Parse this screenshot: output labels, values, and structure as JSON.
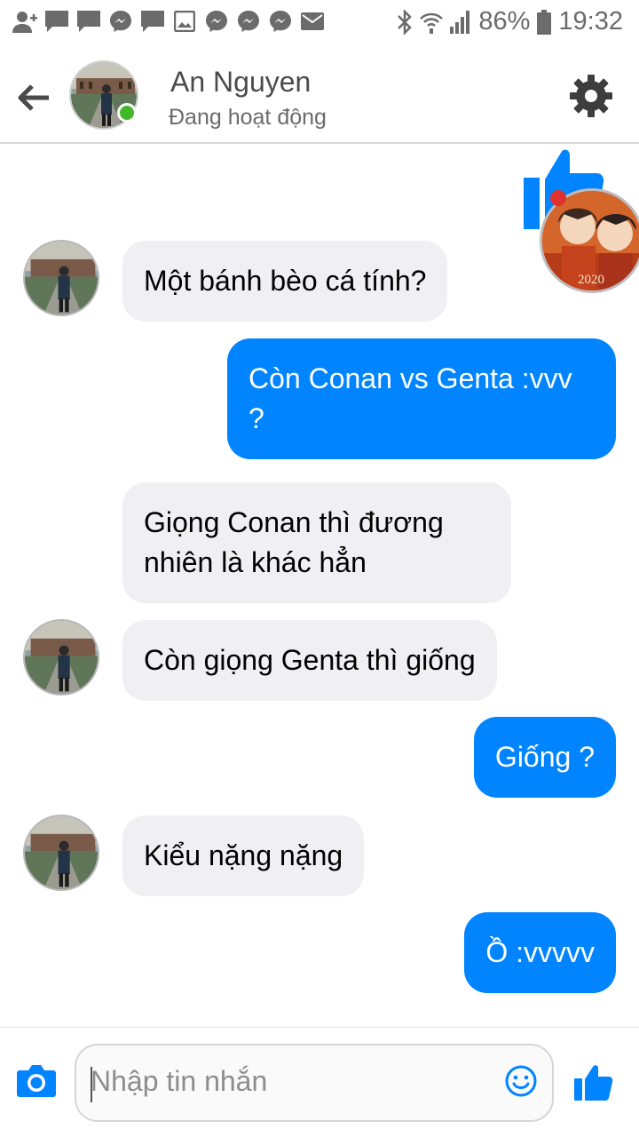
{
  "status_bar": {
    "battery": "86%",
    "time": "19:32"
  },
  "header": {
    "contact_name": "An Nguyen",
    "status_text": "Đang hoạt động",
    "back_icon": "arrow-left-icon",
    "settings_icon": "gear-icon"
  },
  "messages": [
    {
      "side": "in",
      "text": "Một bánh bèo cá tính?"
    },
    {
      "side": "out",
      "text": "Còn Conan vs Genta :vvv\n?"
    },
    {
      "side": "in",
      "text": "Giọng Conan thì đương\nnhiên là khác hẳn"
    },
    {
      "side": "in",
      "text": "Còn giọng Genta thì giống"
    },
    {
      "side": "out",
      "text": "Giống ?"
    },
    {
      "side": "in",
      "text": "Kiểu nặng nặng"
    },
    {
      "side": "out",
      "text": "Ồ :vvvvv"
    }
  ],
  "composer": {
    "placeholder": "Nhập tin nhắn",
    "camera_icon": "camera-icon",
    "emoji_icon": "smiley-icon",
    "send_icon": "thumbs-up-icon"
  },
  "colors": {
    "accent": "#0084ff",
    "incoming_bubble": "#f0f0f4",
    "online": "#42b72a"
  }
}
